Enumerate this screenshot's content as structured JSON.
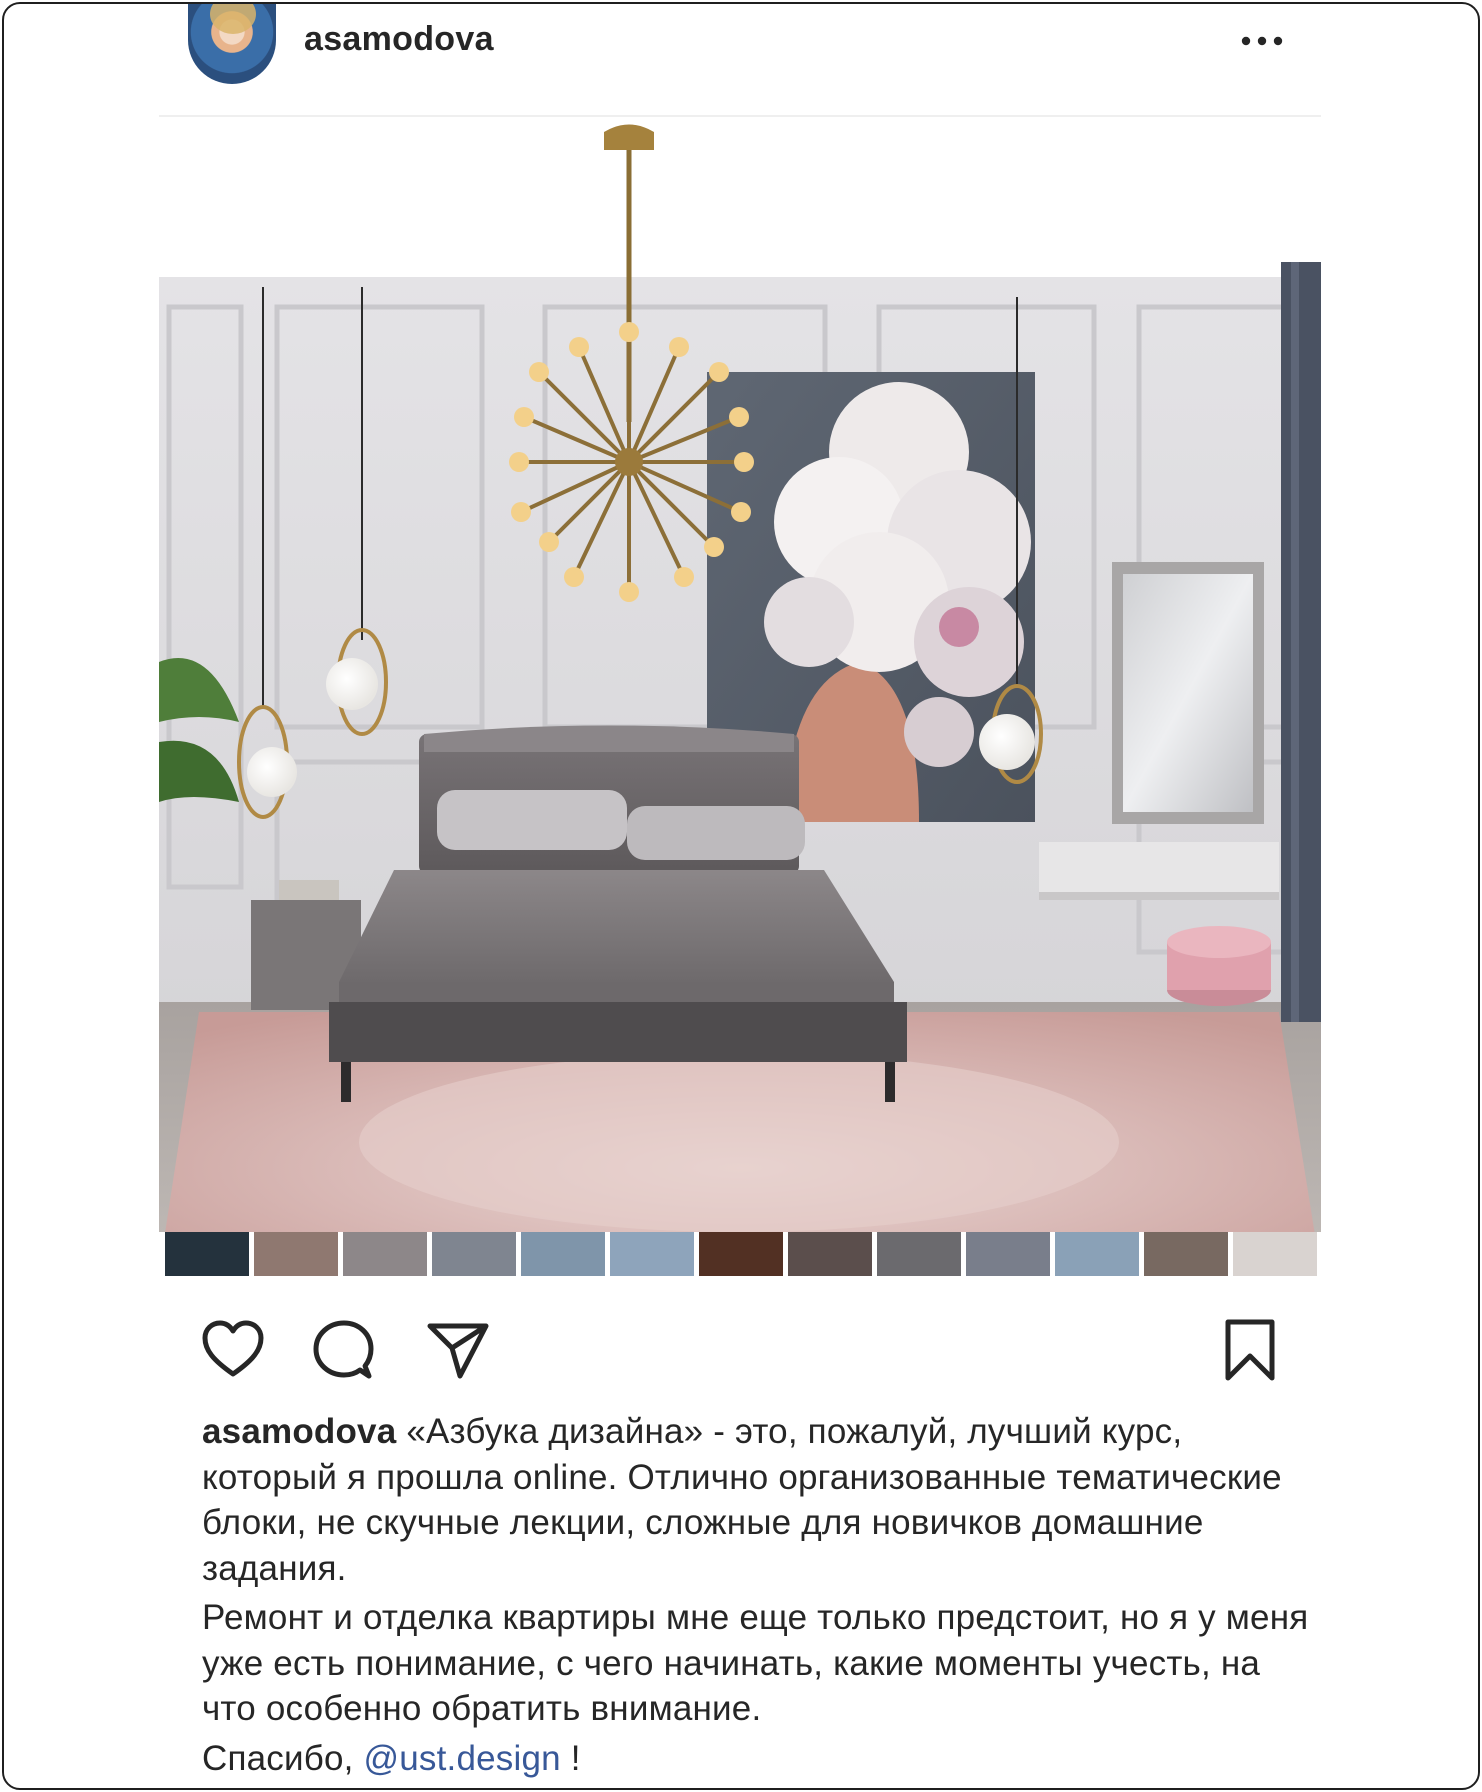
{
  "post": {
    "username": "asamodova",
    "more_icon": "more-horizontal-icon",
    "image_alt": "Bedroom interior collage"
  },
  "palette": {
    "colors": [
      "#24323d",
      "#8f7870",
      "#8d8789",
      "#7f8590",
      "#7f95aa",
      "#8ea4bb",
      "#523023",
      "#5b4e4c",
      "#6b6a6e",
      "#797e8b",
      "#8aa1b7",
      "#786961",
      "#d9d3d0"
    ]
  },
  "actions": {
    "like_icon": "heart-icon",
    "comment_icon": "comment-icon",
    "share_icon": "send-icon",
    "save_icon": "bookmark-icon"
  },
  "caption": {
    "username": "asamodova",
    "paragraph1": " «Азбука дизайна» - это, пожалуй, лучший курс, который я прошла online. Отлично организованные тематические блоки, не скучные лекции, сложные для новичков домашние задания.",
    "paragraph2": "Ремонт и отделка квартиры мне еще только предстоит, но я у меня уже есть понимание, с чего начинать, какие моменты учесть, на что особенно обратить внимание.",
    "thanks": "Спасибо, ",
    "mention": "@ust.design",
    "end": " !"
  },
  "colors": {
    "text": "#262626",
    "mention": "#385898",
    "border": "#1f1f1f"
  }
}
